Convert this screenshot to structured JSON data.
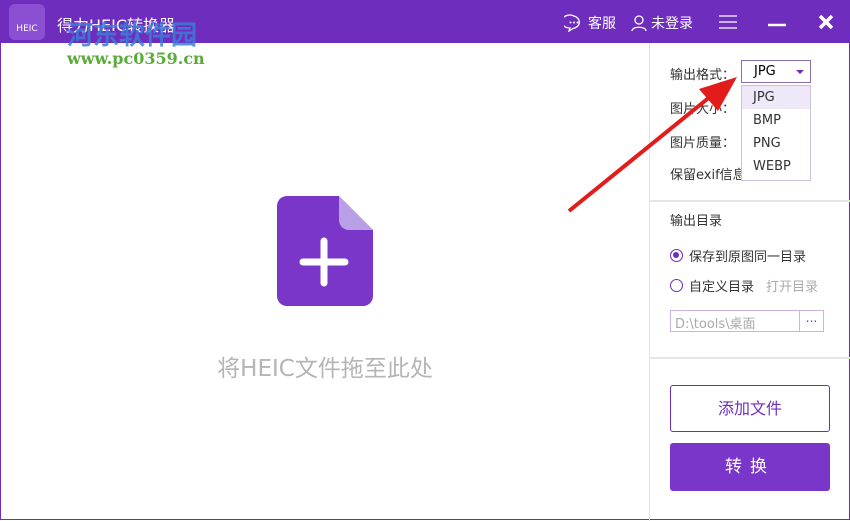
{
  "title": "得力HEIC转换器",
  "logo_text": "HEIC",
  "header": {
    "service": "客服",
    "login": "未登录"
  },
  "watermark": {
    "name": "河东软件园",
    "url": "www.pc0359.cn"
  },
  "drop_hint": "将HEIC文件拖至此处",
  "settings": {
    "format_label": "输出格式：",
    "format_value": "JPG",
    "size_label": "图片大小：",
    "quality_label": "图片质量：",
    "exif_label": "保留exif信息",
    "format_options": [
      "JPG",
      "BMP",
      "PNG",
      "WEBP"
    ]
  },
  "output": {
    "title": "输出目录",
    "same_dir": "保存到原图同一目录",
    "custom_dir": "自定义目录",
    "open_dir": "打开目录",
    "path": "D:\\tools\\桌面",
    "browse": "..."
  },
  "buttons": {
    "add": "添加文件",
    "convert": "转换"
  },
  "colors": {
    "accent": "#6f2dbd",
    "arrow": "#e21b1b"
  }
}
